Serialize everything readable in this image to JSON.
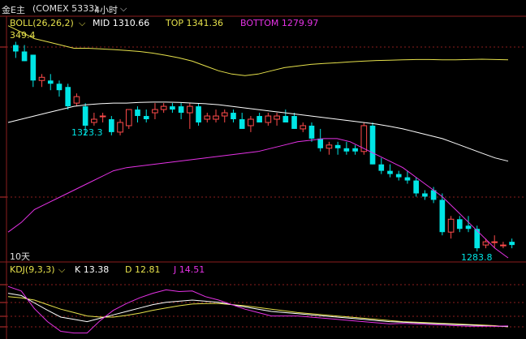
{
  "header": {
    "instrument": "金E主",
    "exchange": "(COMEX 5333)",
    "period": "4小时",
    "colors": {
      "text": "#e0e0e0"
    }
  },
  "boll": {
    "name": "BOLL(26,26,2)",
    "mid": "MID 1310.66",
    "top": "TOP 1341.36",
    "bottom": "BOTTOM 1279.97",
    "colors": {
      "mid": "#ffffff",
      "top": "#e6e14b",
      "bottom": "#e632e6"
    }
  },
  "labels": {
    "top_left_price": "349.4",
    "low_label_1": "1323.3",
    "low_label_2": "1283.8",
    "period_note": "10天"
  },
  "kdj": {
    "name": "KDJ(9,3,3)",
    "k": "K 13.38",
    "d": "D 12.81",
    "j": "J 14.51",
    "colors": {
      "k": "#ffffff",
      "d": "#e6e14b",
      "j": "#e632e6"
    }
  },
  "chart_data": {
    "type": "candlestick",
    "candles": [
      [
        1346,
        1347,
        1342,
        1344
      ],
      [
        1344,
        1346,
        1341,
        1341
      ],
      [
        1343,
        1343,
        1333,
        1335
      ],
      [
        1335,
        1337,
        1333,
        1336
      ],
      [
        1335,
        1337,
        1332,
        1334
      ],
      [
        1334,
        1335,
        1330,
        1332
      ],
      [
        1333,
        1334,
        1326,
        1327
      ],
      [
        1328,
        1331,
        1327,
        1330
      ],
      [
        1327,
        1328,
        1318,
        1321
      ],
      [
        1322,
        1325,
        1321,
        1323
      ],
      [
        1324,
        1325,
        1322,
        1324
      ],
      [
        1323,
        1324,
        1318,
        1319
      ],
      [
        1319,
        1323,
        1318,
        1322
      ],
      [
        1321,
        1326,
        1320,
        1326
      ],
      [
        1326,
        1327,
        1322,
        1324
      ],
      [
        1324,
        1326,
        1322,
        1323
      ],
      [
        1325,
        1328,
        1323,
        1326
      ],
      [
        1326,
        1328,
        1325,
        1327
      ],
      [
        1327,
        1328,
        1325,
        1326
      ],
      [
        1327,
        1328,
        1323,
        1325
      ],
      [
        1325,
        1328,
        1320,
        1327
      ],
      [
        1327,
        1328,
        1321,
        1322
      ],
      [
        1323,
        1325,
        1322,
        1324
      ],
      [
        1323,
        1326,
        1322,
        1324
      ],
      [
        1324,
        1326,
        1322,
        1325
      ],
      [
        1325,
        1326,
        1322,
        1323
      ],
      [
        1323,
        1325,
        1320,
        1320
      ],
      [
        1321,
        1324,
        1319,
        1323
      ],
      [
        1324,
        1325,
        1322,
        1322
      ],
      [
        1322,
        1325,
        1321,
        1324
      ],
      [
        1323,
        1325,
        1321,
        1324
      ],
      [
        1324,
        1326,
        1322,
        1322
      ],
      [
        1324,
        1325,
        1320,
        1320
      ],
      [
        1320,
        1322,
        1319,
        1321
      ],
      [
        1321,
        1322,
        1316,
        1317
      ],
      [
        1317,
        1320,
        1313,
        1314
      ],
      [
        1314,
        1316,
        1312,
        1315
      ],
      [
        1315,
        1316,
        1312,
        1314
      ],
      [
        1314,
        1316,
        1312,
        1313
      ],
      [
        1314,
        1315,
        1312,
        1313
      ],
      [
        1313,
        1322,
        1312,
        1321
      ],
      [
        1321,
        1322,
        1309,
        1309
      ],
      [
        1309,
        1311,
        1306,
        1307
      ],
      [
        1307,
        1309,
        1305,
        1306
      ],
      [
        1306,
        1307,
        1304,
        1305
      ],
      [
        1305,
        1307,
        1303,
        1304
      ],
      [
        1304,
        1305,
        1299,
        1300
      ],
      [
        1300,
        1301,
        1298,
        1299
      ],
      [
        1301,
        1302,
        1297,
        1298
      ],
      [
        1298,
        1300,
        1287,
        1288
      ],
      [
        1288,
        1293,
        1286,
        1292
      ],
      [
        1292,
        1293,
        1288,
        1289
      ],
      [
        1290,
        1293,
        1288,
        1289
      ],
      [
        1289,
        1290,
        1282,
        1283
      ],
      [
        1284,
        1286,
        1283,
        1285
      ],
      [
        1285,
        1287,
        1283,
        1285
      ],
      [
        1284,
        1285,
        1283,
        1284
      ],
      [
        1285,
        1286,
        1283,
        1284
      ]
    ],
    "boll_mid_series": [
      1322,
      1323,
      1324,
      1325,
      1326,
      1327,
      1327.5,
      1327.8,
      1328,
      1328,
      1328.2,
      1328.3,
      1328.3,
      1328.2,
      1328,
      1327.8,
      1327.5,
      1327,
      1326.5,
      1326,
      1325.5,
      1325,
      1324.5,
      1324,
      1323.5,
      1323,
      1322.5,
      1322,
      1321.5,
      1320.8,
      1320,
      1319,
      1318,
      1317,
      1315.5,
      1314,
      1312.5,
      1311,
      1310
    ],
    "boll_top_series": [
      1352,
      1350,
      1348,
      1347,
      1346,
      1345,
      1345,
      1344.8,
      1344.6,
      1344.3,
      1344,
      1343.5,
      1342.8,
      1342,
      1341,
      1339.5,
      1338,
      1337,
      1336.5,
      1337,
      1338,
      1339,
      1339.5,
      1340,
      1340.3,
      1340.5,
      1340.8,
      1341,
      1341.2,
      1341.3,
      1341.4,
      1341.5,
      1341.5,
      1341.4,
      1341.4,
      1341.5,
      1341.6,
      1341.5,
      1341.4
    ],
    "boll_bottom_series": [
      1288,
      1291,
      1295,
      1297,
      1299,
      1301,
      1303,
      1305,
      1307,
      1308,
      1308.5,
      1309,
      1309.5,
      1310,
      1310.5,
      1311,
      1311.5,
      1312,
      1312.5,
      1313,
      1314,
      1315,
      1316,
      1316.5,
      1317,
      1317,
      1316,
      1314,
      1312,
      1310,
      1308,
      1305,
      1302,
      1299,
      1295,
      1291,
      1287,
      1283,
      1280
    ],
    "kdj_k": [
      72,
      68,
      55,
      42,
      30,
      26,
      22,
      28,
      34,
      40,
      46,
      52,
      56,
      58,
      60,
      58,
      56,
      52,
      48,
      44,
      40,
      38,
      36,
      34,
      32,
      30,
      28,
      26,
      24,
      22,
      21,
      20,
      19,
      18,
      17,
      16,
      15,
      14,
      13.4
    ],
    "kdj_d": [
      66,
      64,
      60,
      52,
      44,
      38,
      32,
      30,
      30,
      33,
      37,
      42,
      46,
      50,
      53,
      54,
      54,
      52,
      50,
      47,
      44,
      41,
      38,
      36,
      34,
      32,
      30,
      28,
      26,
      24,
      22,
      21,
      20,
      19,
      18,
      17,
      16,
      15,
      12.8
    ],
    "kdj_j": [
      84,
      76,
      45,
      22,
      5,
      2,
      2,
      24,
      42,
      54,
      64,
      72,
      78,
      75,
      76,
      66,
      60,
      52,
      44,
      38,
      32,
      32,
      32,
      30,
      28,
      26,
      24,
      22,
      20,
      18,
      19,
      18,
      17,
      16,
      15,
      14,
      14,
      14,
      14.5
    ],
    "price_range": [
      1279,
      1349.4
    ],
    "kdj_range": [
      0,
      100
    ]
  }
}
